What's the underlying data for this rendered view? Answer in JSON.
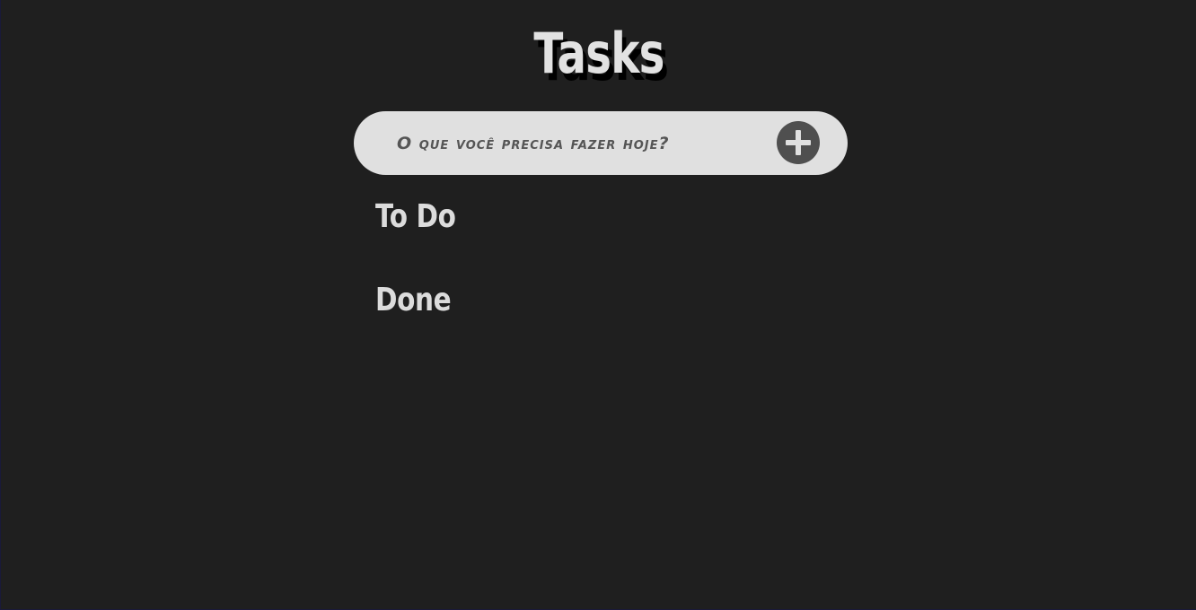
{
  "header": {
    "title": "Tasks"
  },
  "new_task": {
    "placeholder": "O que você precisa fazer hoje?",
    "value": "",
    "add_button_icon": "plus-circle-icon"
  },
  "sections": {
    "todo": {
      "heading": "To Do",
      "items": []
    },
    "done": {
      "heading": "Done",
      "items": []
    }
  },
  "colors": {
    "background": "#1f1f1f",
    "input_background": "#e0e0e0",
    "text_light": "#e2e2e2",
    "add_button": "#4f4f4f",
    "placeholder_text": "#555555"
  }
}
